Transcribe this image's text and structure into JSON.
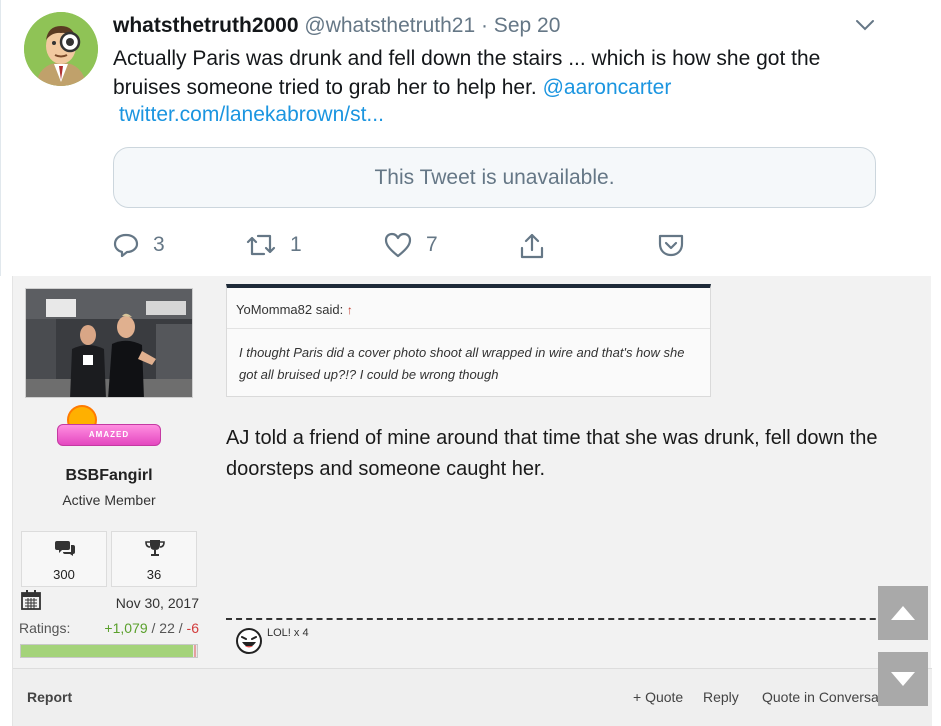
{
  "tweet": {
    "display_name": "whatsthetruth2000",
    "handle": "@whatsthetruth21",
    "date": "· Sep 20",
    "text": "Actually Paris was drunk and fell down the stairs ... which is how she got the bruises someone tried to grab her to help her.",
    "mention": "@aaroncarter",
    "link": "twitter.com/lanekabrown/st...",
    "unavailable": "This Tweet is unavailable.",
    "reply_count": "3",
    "retweet_count": "1",
    "like_count": "7",
    "icons": [
      "reply-icon",
      "retweet-icon",
      "like-icon",
      "share-icon",
      "caret-down-icon"
    ],
    "colors": {
      "link": "#1b95e0",
      "muted": "#657786"
    }
  },
  "forum": {
    "user": {
      "badge": "AMAZED",
      "name": "BSBFangirl",
      "title": "Active Member",
      "messages": "300",
      "trophies": "36",
      "joined": "Nov 30, 2017",
      "ratings_label": "Ratings:",
      "ratings_pos": "+1,079",
      "ratings_sep1": " / ",
      "ratings_neu": "22",
      "ratings_sep2": " / ",
      "ratings_neg": "-6",
      "rating_positive_fraction": 0.98
    },
    "quote": {
      "author": "YoMomma82 said:",
      "arrow": "↑",
      "text": "I thought Paris did a cover photo shoot all wrapped in wire and that's how she got all bruised up?!? I could be wrong though"
    },
    "post_text": "AJ told a friend of mine around that time that she was drunk, fell down the doorsteps and someone caught her.",
    "reaction": "LOL! x 4",
    "footer": {
      "report": "Report",
      "quote": "+ Quote",
      "reply": "Reply",
      "quote_conv": "Quote in Conversation"
    }
  }
}
